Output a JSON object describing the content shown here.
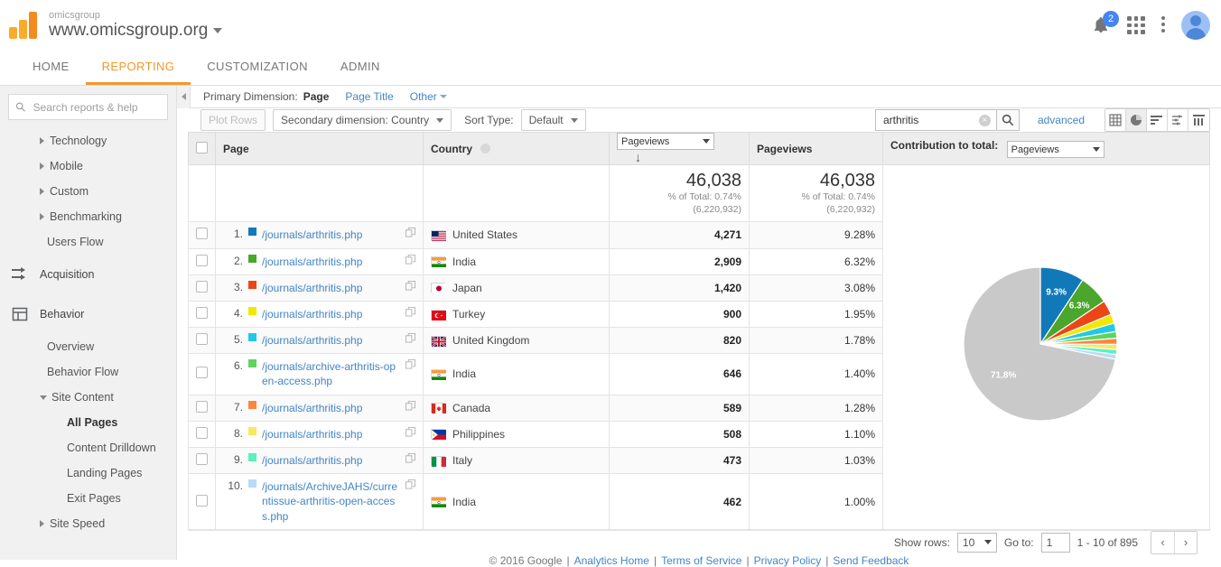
{
  "header": {
    "account_name": "omicsgroup",
    "property_url": "www.omicsgroup.org",
    "notifications_count": "2",
    "icons": {
      "bell": "bell-icon",
      "apps": "apps-grid-icon",
      "more": "kebab-menu-icon",
      "avatar": "user-avatar"
    }
  },
  "nav": {
    "tabs": [
      {
        "label": "HOME",
        "active": false
      },
      {
        "label": "REPORTING",
        "active": true
      },
      {
        "label": "CUSTOMIZATION",
        "active": false
      },
      {
        "label": "ADMIN",
        "active": false
      }
    ]
  },
  "sidebar": {
    "search_placeholder": "Search reports & help",
    "items": [
      {
        "label": "Technology",
        "type": "collapsed"
      },
      {
        "label": "Mobile",
        "type": "collapsed"
      },
      {
        "label": "Custom",
        "type": "collapsed"
      },
      {
        "label": "Benchmarking",
        "type": "collapsed"
      },
      {
        "label": "Users Flow",
        "type": "plain"
      },
      {
        "label": "Acquisition",
        "type": "section",
        "icon": "acquisition-arrows-icon"
      },
      {
        "label": "Behavior",
        "type": "section",
        "icon": "behavior-panel-icon"
      },
      {
        "label": "Overview",
        "type": "plain"
      },
      {
        "label": "Behavior Flow",
        "type": "plain"
      },
      {
        "label": "Site Content",
        "type": "expanded"
      },
      {
        "label": "All Pages",
        "type": "sub",
        "selected": true
      },
      {
        "label": "Content Drilldown",
        "type": "sub"
      },
      {
        "label": "Landing Pages",
        "type": "sub"
      },
      {
        "label": "Exit Pages",
        "type": "sub"
      },
      {
        "label": "Site Speed",
        "type": "collapsed"
      }
    ]
  },
  "dimension_bar": {
    "label": "Primary Dimension:",
    "current": "Page",
    "link_page_title": "Page Title",
    "link_other": "Other"
  },
  "toolbar": {
    "plot_rows": "Plot Rows",
    "secondary_dimension": "Secondary dimension: Country",
    "sort_type_label": "Sort Type:",
    "sort_type_value": "Default",
    "search_value": "arthritis",
    "advanced": "advanced",
    "view_icons": [
      {
        "name": "table-view-icon",
        "active": false
      },
      {
        "name": "pie-chart-view-icon",
        "active": true
      },
      {
        "name": "performance-view-icon",
        "active": false
      },
      {
        "name": "comparison-view-icon",
        "active": false
      },
      {
        "name": "pivot-view-icon",
        "active": false
      }
    ]
  },
  "table": {
    "columns": {
      "page": "Page",
      "country": "Country",
      "metric_select": "Pageviews",
      "pageviews": "Pageviews",
      "contribution_label": "Contribution to total:",
      "contribution_value": "Pageviews"
    },
    "totals": {
      "pageviews": "46,038",
      "pct_of_total": "% of Total: 0.74%",
      "grand_total": "(6,220,932)",
      "pageviews2": "46,038",
      "pct_of_total2": "% of Total: 0.74%",
      "grand_total2": "(6,220,932)"
    },
    "rows": [
      {
        "n": "1.",
        "color": "#1279b8",
        "page": "/journals/arthritis.php",
        "country": "United States",
        "flag": "us",
        "pageviews": "4,271",
        "pct": "9.28%"
      },
      {
        "n": "2.",
        "color": "#4aa62c",
        "page": "/journals/arthritis.php",
        "country": "India",
        "flag": "in",
        "pageviews": "2,909",
        "pct": "6.32%"
      },
      {
        "n": "3.",
        "color": "#ec4617",
        "page": "/journals/arthritis.php",
        "country": "Japan",
        "flag": "jp",
        "pageviews": "1,420",
        "pct": "3.08%"
      },
      {
        "n": "4.",
        "color": "#f2e800",
        "page": "/journals/arthritis.php",
        "country": "Turkey",
        "flag": "tr",
        "pageviews": "900",
        "pct": "1.95%"
      },
      {
        "n": "5.",
        "color": "#22c8e8",
        "page": "/journals/arthritis.php",
        "country": "United Kingdom",
        "flag": "gb",
        "pageviews": "820",
        "pct": "1.78%"
      },
      {
        "n": "6.",
        "color": "#5ed45e",
        "page": "/journals/archive-arthritis-open-access.php",
        "country": "India",
        "flag": "in",
        "pageviews": "646",
        "pct": "1.40%"
      },
      {
        "n": "7.",
        "color": "#f9873f",
        "page": "/journals/arthritis.php",
        "country": "Canada",
        "flag": "ca",
        "pageviews": "589",
        "pct": "1.28%"
      },
      {
        "n": "8.",
        "color": "#fae95c",
        "page": "/journals/arthritis.php",
        "country": "Philippines",
        "flag": "ph",
        "pageviews": "508",
        "pct": "1.10%"
      },
      {
        "n": "9.",
        "color": "#5cf0bc",
        "page": "/journals/arthritis.php",
        "country": "Italy",
        "flag": "it",
        "pageviews": "473",
        "pct": "1.03%"
      },
      {
        "n": "10.",
        "color": "#b8dcf7",
        "page": "/journals/ArchiveJAHS/currentissue-arthritis-open-access.php",
        "country": "India",
        "flag": "in",
        "pageviews": "462",
        "pct": "1.00%"
      }
    ]
  },
  "chart_data": {
    "type": "pie",
    "title": "",
    "labels_shown": [
      "9.3%",
      "6.3%",
      "71.8%"
    ],
    "slices": [
      {
        "label": "United States",
        "value": 9.3,
        "color": "#1279b8",
        "show_label": true
      },
      {
        "label": "India",
        "value": 6.3,
        "color": "#4aa62c",
        "show_label": true
      },
      {
        "label": "Japan",
        "value": 3.08,
        "color": "#ec4617",
        "show_label": false
      },
      {
        "label": "Turkey",
        "value": 1.95,
        "color": "#f2e800",
        "show_label": false
      },
      {
        "label": "United Kingdom",
        "value": 1.78,
        "color": "#22c8e8",
        "show_label": false
      },
      {
        "label": "India",
        "value": 1.4,
        "color": "#5ed45e",
        "show_label": false
      },
      {
        "label": "Canada",
        "value": 1.28,
        "color": "#f9873f",
        "show_label": false
      },
      {
        "label": "Philippines",
        "value": 1.1,
        "color": "#fae95c",
        "show_label": false
      },
      {
        "label": "Italy",
        "value": 1.03,
        "color": "#5cf0bc",
        "show_label": false
      },
      {
        "label": "India",
        "value": 1.0,
        "color": "#b8dcf7",
        "show_label": false
      },
      {
        "label": "Other",
        "value": 71.8,
        "color": "#c9c9c9",
        "show_label": true
      }
    ],
    "legend_position": "none"
  },
  "footer": {
    "show_rows_label": "Show rows:",
    "show_rows_value": "10",
    "go_to_label": "Go to:",
    "go_to_value": "1",
    "range_text": "1 - 10 of 895",
    "prev": "‹",
    "next": "›",
    "copyright": "© 2016 Google",
    "links": [
      "Analytics Home",
      "Terms of Service",
      "Privacy Policy",
      "Send Feedback"
    ]
  }
}
